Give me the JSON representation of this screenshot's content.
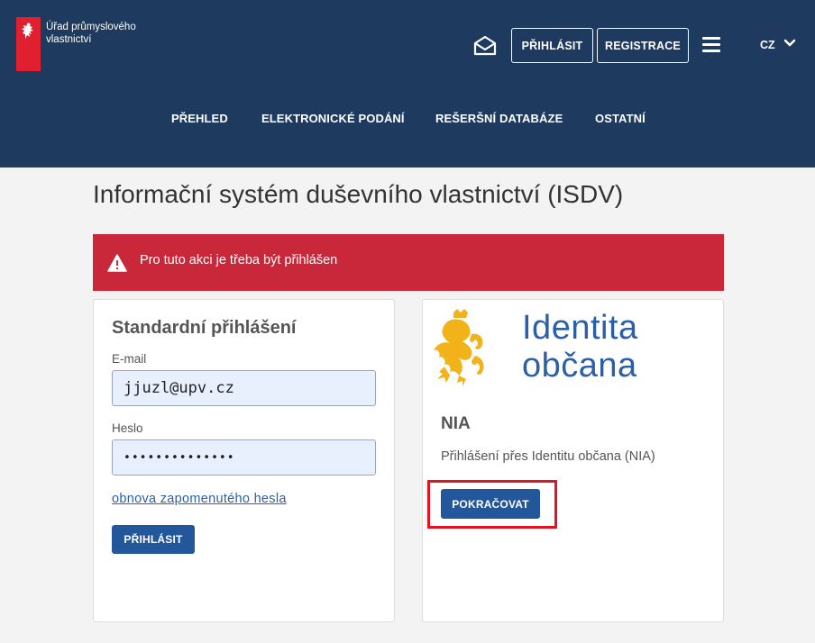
{
  "header": {
    "logo_text": "Úřad průmyslového vlastnictví",
    "login_label": "PŘIHLÁSIT",
    "register_label": "REGISTRACE",
    "language": "CZ"
  },
  "nav": {
    "items": [
      "PŘEHLED",
      "ELEKTRONICKÉ PODÁNÍ",
      "REŠERŠNÍ DATABÁZE",
      "OSTATNÍ"
    ]
  },
  "page": {
    "title": "Informační systém duševního vlastnictví (ISDV)"
  },
  "alert": {
    "message": "Pro tuto akci je třeba být přihlášen",
    "color": "#c8283a"
  },
  "standard_login": {
    "title": "Standardní přihlášení",
    "email_label": "E-mail",
    "email_value": "jjuzl@upv.cz",
    "password_label": "Heslo",
    "password_value": "••••••••••••••",
    "forgot_link": "obnova zapomenutého hesla",
    "submit_label": "PŘIHLÁSIT"
  },
  "nia_login": {
    "brand_line1": "Identita",
    "brand_line2": "občana",
    "heading": "NIA",
    "description": "Přihlášení přes Identitu občana (NIA)",
    "continue_label": "POKRAČOVAT"
  },
  "colors": {
    "header_bg": "#1e3a5f",
    "primary": "#23579b",
    "link": "#2b5fa8",
    "highlight": "#e4131f"
  }
}
